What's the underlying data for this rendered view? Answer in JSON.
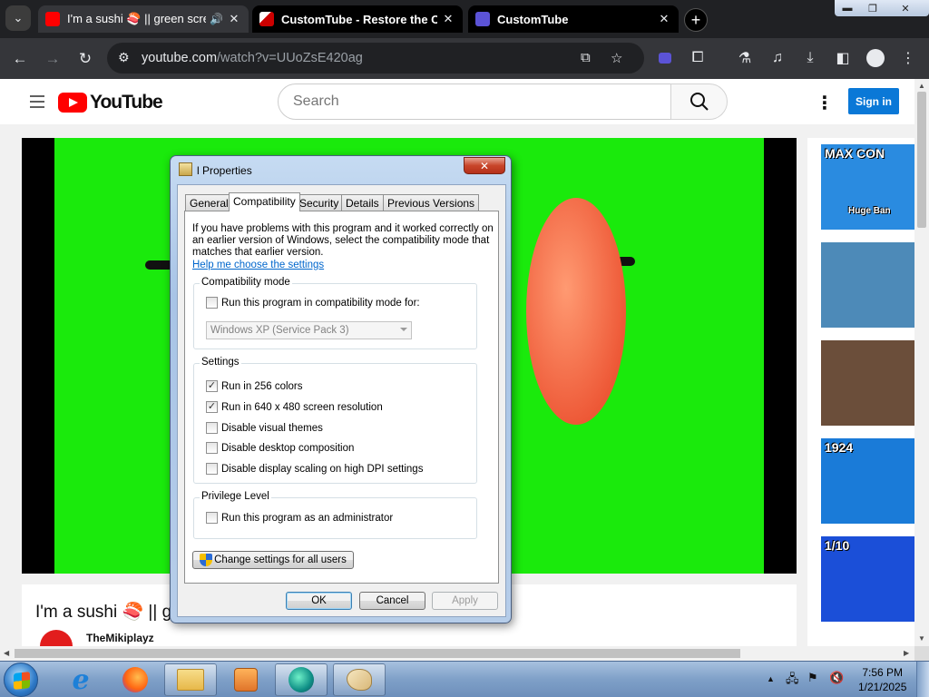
{
  "browser": {
    "tabs": [
      {
        "title": "I'm a sushi 🍣 || green scre",
        "active": true
      },
      {
        "title": "CustomTube - Restore the Old",
        "active": false
      },
      {
        "title": "CustomTube",
        "active": false
      }
    ],
    "url_host": "youtube.com",
    "url_path": "/watch?v=UUoZsE420ag",
    "icons": [
      "search-tabs-icon",
      "back-icon",
      "forward-icon",
      "reload-icon",
      "site-info-icon",
      "install-app-icon",
      "star-icon",
      "customtube-extension-icon",
      "extensions-icon",
      "labs-icon",
      "media-controls-icon",
      "download-icon",
      "side-panel-icon",
      "profile-icon",
      "menu-icon"
    ]
  },
  "youtube": {
    "logo_text": "YouTube",
    "search_placeholder": "Search",
    "sign_in_label": "Sign in",
    "video_title": "I'm a sushi 🍣 || g",
    "channel_name": "TheMikiplayz",
    "sidebar_thumbs": [
      {
        "label": "MAX CON",
        "sub": "Huge Ban",
        "color": "#2a8be0"
      },
      {
        "label": "",
        "sub": "",
        "color": "#4d8ab8"
      },
      {
        "label": "",
        "sub": "",
        "color": "#6b4e3a"
      },
      {
        "label": "1924",
        "sub": "",
        "color": "#1a7bd8"
      },
      {
        "label": "1/10",
        "sub": "",
        "color": "#1b4fd8"
      }
    ]
  },
  "dialog": {
    "title": "l Properties",
    "close_label": "✕",
    "tabs": [
      "General",
      "Compatibility",
      "Security",
      "Details",
      "Previous Versions"
    ],
    "selected_tab": "Compatibility",
    "intro_lines": [
      "If you have problems with this program and it worked correctly on",
      "an earlier version of Windows, select the compatibility mode that",
      "matches that earlier version."
    ],
    "help_link": "Help me choose the settings",
    "compat_group": {
      "title": "Compatibility mode",
      "checkbox": {
        "label": "Run this program in compatibility mode for:",
        "checked": false
      },
      "select_value": "Windows XP (Service Pack 3)"
    },
    "settings_group": {
      "title": "Settings",
      "options": [
        {
          "label": "Run in 256 colors",
          "checked": true
        },
        {
          "label": "Run in 640 x 480 screen resolution",
          "checked": true
        },
        {
          "label": "Disable visual themes",
          "checked": false
        },
        {
          "label": "Disable desktop composition",
          "checked": false
        },
        {
          "label": "Disable display scaling on high DPI settings",
          "checked": false
        }
      ]
    },
    "privilege_group": {
      "title": "Privilege Level",
      "checkbox": {
        "label": "Run this program as an administrator",
        "checked": false
      }
    },
    "change_all_label": "Change settings for all users",
    "ok_label": "OK",
    "cancel_label": "Cancel",
    "apply_label": "Apply"
  },
  "taskbar": {
    "apps": [
      "internet-explorer-icon",
      "firefox-icon",
      "file-explorer-icon",
      "media-player-icon",
      "customtube-app-icon",
      "paint-icon"
    ],
    "time": "7:56 PM",
    "date": "1/21/2025",
    "tray_icons": [
      "show-hidden-icons",
      "network-icon",
      "action-center-flag-icon",
      "volume-muted-icon"
    ]
  }
}
